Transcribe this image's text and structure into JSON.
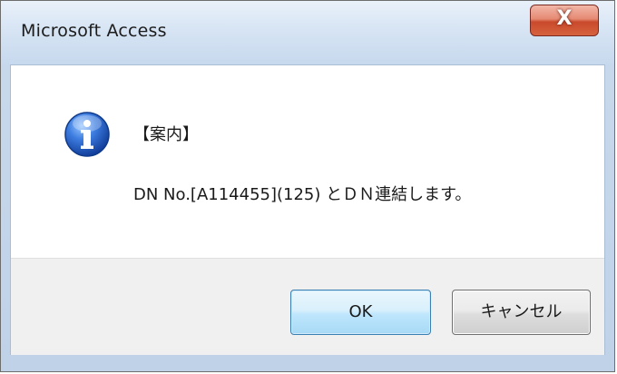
{
  "window": {
    "title": "Microsoft Access",
    "close_label": "X"
  },
  "dialog": {
    "icon": "info-icon",
    "heading": "【案内】",
    "message": "DN No.[A114455](125) とＤＮ連結します。"
  },
  "buttons": {
    "ok_label": "OK",
    "cancel_label": "キャンセル"
  },
  "colors": {
    "title_gradient_top": "#e9f1fa",
    "close_red": "#c94a2c",
    "ok_border": "#3c7fb1",
    "info_blue": "#1f56c8",
    "footer_bg": "#f0f0f0"
  }
}
